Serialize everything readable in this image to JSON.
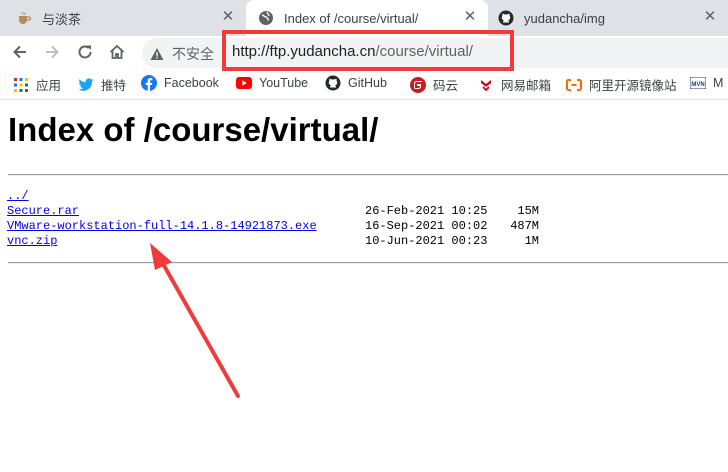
{
  "browser": {
    "tabs": [
      {
        "title": "与淡茶",
        "icon": "tea-icon",
        "active": false
      },
      {
        "title": "Index of /course/virtual/",
        "icon": "globe-icon",
        "active": true
      },
      {
        "title": "yudancha/img",
        "icon": "github-icon",
        "active": false
      }
    ],
    "security_label": "不安全",
    "url_host": "http://ftp.yudancha.cn",
    "url_path": "/course/virtual/",
    "highlight_color": "#ef3b3b",
    "bookmarks": [
      {
        "label": "应用",
        "icon": "apps-grid-icon"
      },
      {
        "label": "推特",
        "icon": "twitter-icon"
      },
      {
        "label": "Facebook",
        "icon": "facebook-icon"
      },
      {
        "label": "YouTube",
        "icon": "youtube-icon"
      },
      {
        "label": "GitHub",
        "icon": "github-icon"
      },
      {
        "label": "码云",
        "icon": "gitee-icon"
      },
      {
        "label": "网易邮箱",
        "icon": "netease-icon"
      },
      {
        "label": "阿里开源镜像站",
        "icon": "aliyun-icon"
      },
      {
        "label": "M",
        "icon": "mvn-icon"
      }
    ]
  },
  "page": {
    "heading": "Index of /course/virtual/",
    "parent_link": "../",
    "files": [
      {
        "name": "Secure.rar",
        "date": "26-Feb-2021 10:25",
        "size": "15M"
      },
      {
        "name": "VMware-workstation-full-14.1.8-14921873.exe",
        "date": "16-Sep-2021 00:02",
        "size": "487M"
      },
      {
        "name": "vnc.zip",
        "date": "10-Jun-2021 00:23",
        "size": "1M"
      }
    ]
  },
  "annotation": {
    "arrow_color": "#ef3b3b"
  }
}
